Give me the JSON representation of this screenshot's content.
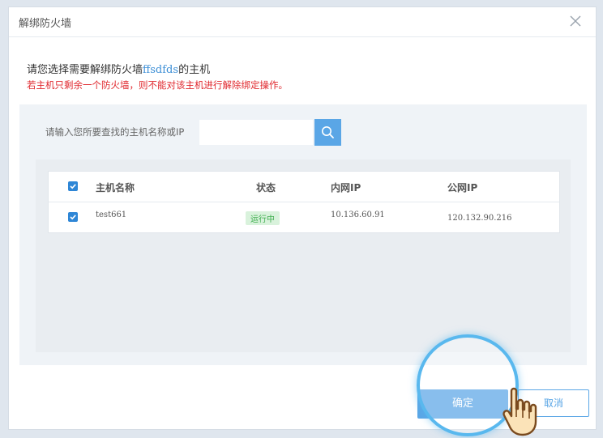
{
  "dialog": {
    "title": "解绑防火墙",
    "close_icon": "close-icon",
    "heading_prefix": "请您选择需要解绑防火墙",
    "firewall_name": "ffsdfds",
    "heading_suffix": "的主机",
    "warning": "若主机只剩余一个防火墙，则不能对该主机进行解除绑定操作。"
  },
  "search": {
    "label": "请输入您所要查找的主机名称或IP",
    "value": "",
    "icon": "search-icon"
  },
  "table": {
    "columns": [
      "主机名称",
      "状态",
      "内网IP",
      "公网IP"
    ],
    "header_checked": true,
    "rows": [
      {
        "checked": true,
        "host": "test661",
        "status": "运行中",
        "private_ip": "10.136.60.91",
        "public_ip": "120.132.90.216"
      }
    ]
  },
  "buttons": {
    "confirm": "确定",
    "cancel": "取消"
  },
  "overlay": {
    "highlight": "highlight-ring",
    "pointer_icon": "hand-pointer-icon"
  },
  "colors": {
    "accent": "#5aa6e6",
    "checkbox": "#2e86d6",
    "warning": "#e0282e",
    "status_bg": "#d9f2dc",
    "status_text": "#3fae4f"
  }
}
